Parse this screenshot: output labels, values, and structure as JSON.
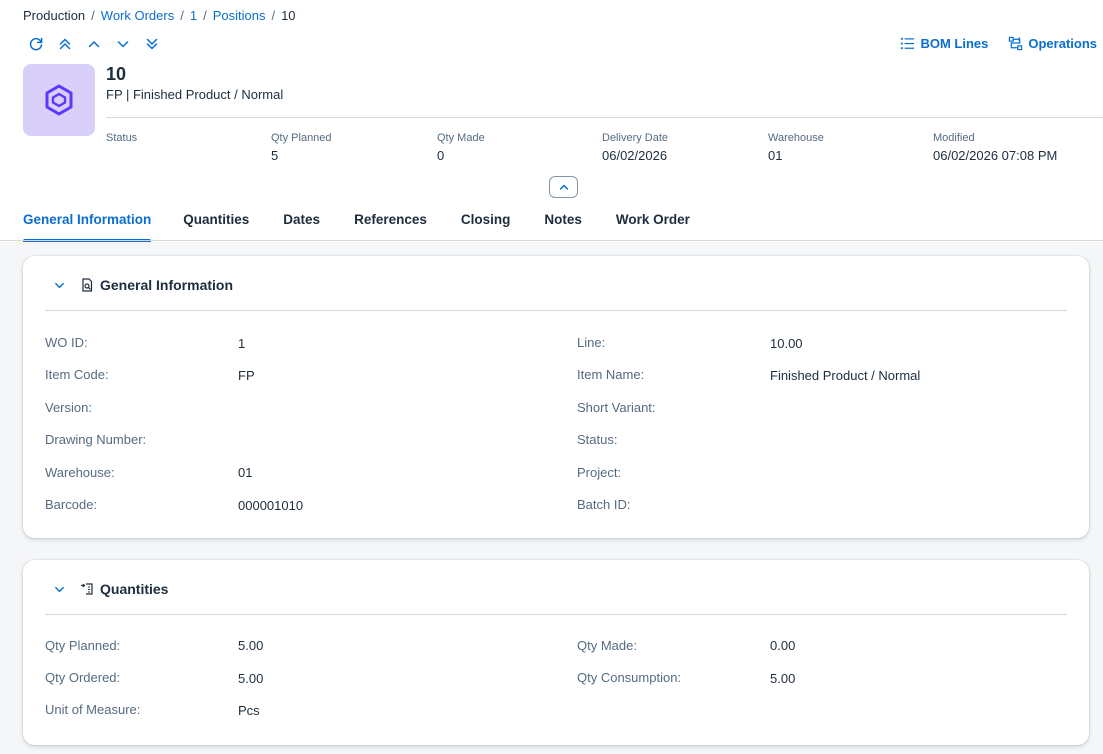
{
  "breadcrumb": {
    "root": "Production",
    "links": [
      "Work Orders",
      "1",
      "Positions"
    ],
    "current": "10",
    "separator": "/"
  },
  "nav_icons": [
    "refresh-icon",
    "first-icon",
    "previous-icon",
    "next-icon",
    "last-icon"
  ],
  "actions": {
    "bom_lines": "BOM Lines",
    "operations": "Operations"
  },
  "object": {
    "title": "10",
    "subtitle": "FP | Finished Product / Normal",
    "avatar_icon": "cube-icon",
    "avatar_color": "#d9d0fa",
    "icon_color": "#5d36ff"
  },
  "kpis": [
    {
      "label": "Status",
      "value": ""
    },
    {
      "label": "Qty Planned",
      "value": "5"
    },
    {
      "label": "Qty Made",
      "value": "0"
    },
    {
      "label": "Delivery Date",
      "value": "06/02/2026"
    },
    {
      "label": "Warehouse",
      "value": "01"
    },
    {
      "label": "Modified",
      "value": "06/02/2026 07:08 PM"
    }
  ],
  "tabs": [
    {
      "label": "General Information",
      "active": true
    },
    {
      "label": "Quantities",
      "active": false
    },
    {
      "label": "Dates",
      "active": false
    },
    {
      "label": "References",
      "active": false
    },
    {
      "label": "Closing",
      "active": false
    },
    {
      "label": "Notes",
      "active": false
    },
    {
      "label": "Work Order",
      "active": false
    }
  ],
  "general": {
    "title": "General Information",
    "fields": [
      {
        "label": "WO ID:",
        "value": "1"
      },
      {
        "label": "Line:",
        "value": "10.00"
      },
      {
        "label": "Item Code:",
        "value": "FP"
      },
      {
        "label": "Item Name:",
        "value": "Finished Product / Normal"
      },
      {
        "label": "Version:",
        "value": ""
      },
      {
        "label": "Short Variant:",
        "value": ""
      },
      {
        "label": "Drawing Number:",
        "value": ""
      },
      {
        "label": "Status:",
        "value": ""
      },
      {
        "label": "Warehouse:",
        "value": "01"
      },
      {
        "label": "Project:",
        "value": ""
      },
      {
        "label": "Barcode:",
        "value": "000001010"
      },
      {
        "label": "Batch ID:",
        "value": ""
      }
    ]
  },
  "quantities": {
    "title": "Quantities",
    "fields": [
      {
        "label": "Qty Planned:",
        "value": "5.00"
      },
      {
        "label": "Qty Made:",
        "value": "0.00"
      },
      {
        "label": "Qty Ordered:",
        "value": "5.00"
      },
      {
        "label": "Qty Consumption:",
        "value": "5.00"
      },
      {
        "label": "Unit of Measure:",
        "value": "Pcs"
      }
    ]
  },
  "colors": {
    "link": "#0a6ed1",
    "text": "#1d2d3e",
    "label": "#556b82",
    "background": "#f5f6f7"
  }
}
